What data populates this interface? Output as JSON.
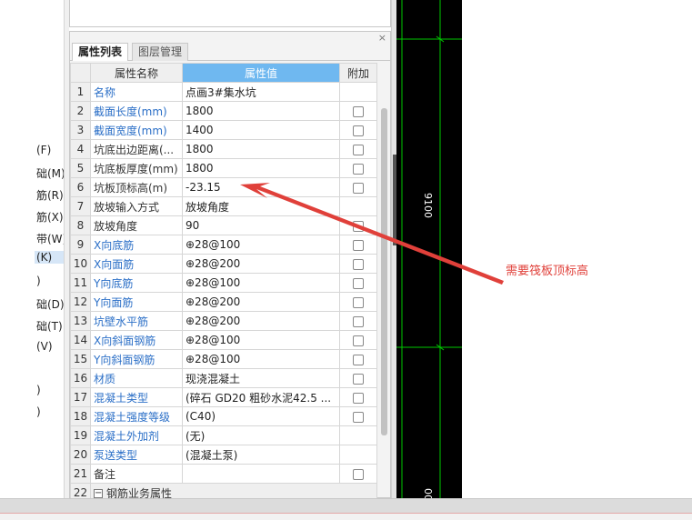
{
  "left_menu": {
    "items": [
      {
        "label": "(F)",
        "selected": false
      },
      {
        "label": "础(M)",
        "selected": false
      },
      {
        "label": "筋(R)",
        "selected": false
      },
      {
        "label": "筋(X)",
        "selected": false
      },
      {
        "label": "带(W)",
        "selected": false
      },
      {
        "label": "(K)",
        "selected": true
      },
      {
        "label": ")",
        "selected": false
      },
      {
        "label": "础(D)",
        "selected": false
      },
      {
        "label": "础(T)",
        "selected": false
      },
      {
        "label": "(V)",
        "selected": false
      },
      {
        "label": ")",
        "selected": false
      },
      {
        "label": ")",
        "selected": false
      }
    ]
  },
  "panel": {
    "close_label": "×",
    "tabs": [
      {
        "label": "属性列表",
        "active": true
      },
      {
        "label": "图层管理",
        "active": false
      }
    ],
    "columns": {
      "num": "",
      "name": "属性名称",
      "value": "属性值",
      "add": "附加"
    },
    "rows": [
      {
        "num": "1",
        "name": "名称",
        "value": "点画3#集水坑",
        "blue": true,
        "checkbox": false
      },
      {
        "num": "2",
        "name": "截面长度(mm)",
        "value": "1800",
        "blue": true,
        "checkbox": true
      },
      {
        "num": "3",
        "name": "截面宽度(mm)",
        "value": "1400",
        "blue": true,
        "checkbox": true
      },
      {
        "num": "4",
        "name": "坑底出边距离(...",
        "value": "1800",
        "blue": false,
        "checkbox": true
      },
      {
        "num": "5",
        "name": "坑底板厚度(mm)",
        "value": "1800",
        "blue": false,
        "checkbox": true
      },
      {
        "num": "6",
        "name": "坑板顶标高(m)",
        "value": "-23.15",
        "blue": false,
        "checkbox": true
      },
      {
        "num": "7",
        "name": "放坡输入方式",
        "value": "放坡角度",
        "blue": false,
        "checkbox": false
      },
      {
        "num": "8",
        "name": "放坡角度",
        "value": "90",
        "blue": false,
        "checkbox": true
      },
      {
        "num": "9",
        "name": "X向底筋",
        "value": "⊕28@100",
        "blue": true,
        "checkbox": true
      },
      {
        "num": "10",
        "name": "X向面筋",
        "value": "⊕28@200",
        "blue": true,
        "checkbox": true
      },
      {
        "num": "11",
        "name": "Y向底筋",
        "value": "⊕28@100",
        "blue": true,
        "checkbox": true
      },
      {
        "num": "12",
        "name": "Y向面筋",
        "value": "⊕28@200",
        "blue": true,
        "checkbox": true
      },
      {
        "num": "13",
        "name": "坑壁水平筋",
        "value": "⊕28@200",
        "blue": true,
        "checkbox": true
      },
      {
        "num": "14",
        "name": "X向斜面钢筋",
        "value": "⊕28@100",
        "blue": true,
        "checkbox": true
      },
      {
        "num": "15",
        "name": "Y向斜面钢筋",
        "value": "⊕28@100",
        "blue": true,
        "checkbox": true
      },
      {
        "num": "16",
        "name": "材质",
        "value": "现浇混凝土",
        "blue": true,
        "checkbox": true
      },
      {
        "num": "17",
        "name": "混凝土类型",
        "value": "(碎石 GD20 粗砂水泥42.5 ...",
        "blue": true,
        "checkbox": true
      },
      {
        "num": "18",
        "name": "混凝土强度等级",
        "value": "(C40)",
        "blue": true,
        "checkbox": true
      },
      {
        "num": "19",
        "name": "混凝土外加剂",
        "value": "(无)",
        "blue": true,
        "checkbox": false
      },
      {
        "num": "20",
        "name": "泵送类型",
        "value": "(混凝土泵)",
        "blue": true,
        "checkbox": false
      },
      {
        "num": "21",
        "name": "备注",
        "value": "",
        "blue": false,
        "checkbox": true
      },
      {
        "num": "22",
        "name": "钢筋业务属性",
        "value": "",
        "blue": false,
        "checkbox": false,
        "group": true,
        "fold": "−"
      }
    ]
  },
  "cad": {
    "dimension_label": "9100",
    "bottom_label": "00",
    "line_color": "#00c800"
  },
  "annotation": {
    "text": "需要筏板顶标高",
    "color": "#e0403a"
  }
}
